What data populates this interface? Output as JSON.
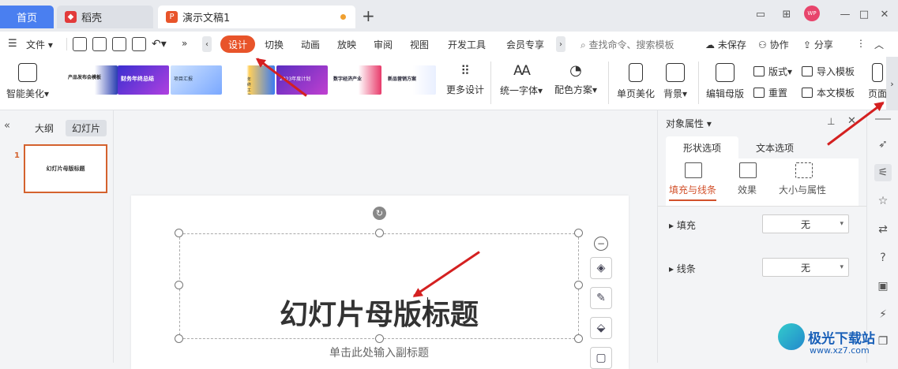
{
  "tabs": {
    "home": "首页",
    "daoke": "稻壳",
    "doc": "演示文稿1",
    "avatar": "WP"
  },
  "menu": {
    "file": "文件",
    "design": "设计",
    "items": [
      "切换",
      "动画",
      "放映",
      "审阅",
      "视图",
      "开发工具",
      "会员专享"
    ],
    "search_placeholder": "查找命令、搜索模板",
    "unsaved": "未保存",
    "collab": "协作",
    "share": "分享"
  },
  "ribbon": {
    "smart_beautify": "智能美化",
    "more_design": "更多设计",
    "unify_font": "统一字体",
    "color_scheme": "配色方案",
    "single_page": "单页美化",
    "background": "背景",
    "edit_master": "编辑母版",
    "layout": "版式",
    "reset": "重置",
    "import_template": "导入模板",
    "this_template": "本文模板",
    "page": "页面",
    "thumbnails": [
      "产品发布会模板",
      "财务年终总结",
      "项目汇报",
      "年终工作汇报",
      "2023年度计划",
      "数字经济产业",
      "新品营销方案"
    ]
  },
  "left": {
    "outline": "大纲",
    "slides": "幻灯片",
    "slide_num": "1",
    "thumb_title": "幻灯片母版标题"
  },
  "slide": {
    "title": "幻灯片母版标题",
    "subtitle": "单击此处输入副标题"
  },
  "props": {
    "title": "对象属性",
    "tab_shape": "形状选项",
    "tab_text": "文本选项",
    "sub_fill": "填充与线条",
    "sub_effect": "效果",
    "sub_size": "大小与属性",
    "fill_label": "填充",
    "fill_value": "无",
    "line_label": "线条",
    "line_value": "无"
  },
  "watermark": {
    "name": "极光下载站",
    "url": "www.xz7.com"
  },
  "colors": {
    "accent": "#e8542a",
    "home_tab": "#4a7ff0",
    "arrow": "#d42020"
  }
}
